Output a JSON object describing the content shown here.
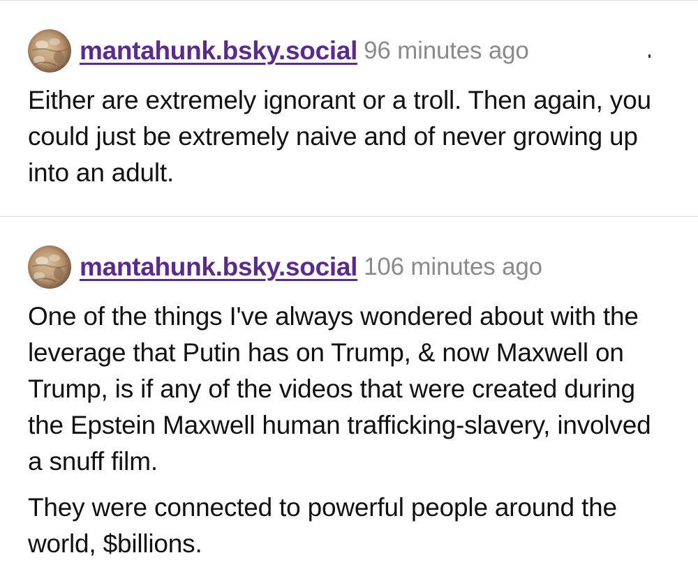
{
  "posts": [
    {
      "avatar_icon": "avatar-icon",
      "handle": "mantahunk.bsky.social",
      "time": "96 minutes ago",
      "paragraphs": [
        "Either are extremely ignorant or a troll. Then again, you could just be extremely naive and of never growing up into an adult."
      ]
    },
    {
      "avatar_icon": "avatar-icon",
      "handle": "mantahunk.bsky.social",
      "time": "106 minutes ago",
      "paragraphs": [
        "One of the things I've always wondered about with the leverage that Putin has on Trump, & now Maxwell on Trump, is if any of the videos that were created during the Epstein Maxwell human trafficking-slavery, involved a snuff film.",
        "They were connected to powerful people around the world, $billions."
      ]
    }
  ],
  "colors": {
    "handle": "#5a2a8c",
    "timestamp": "#8a8a8a",
    "text": "#111111",
    "divider": "#dcdcdc"
  }
}
